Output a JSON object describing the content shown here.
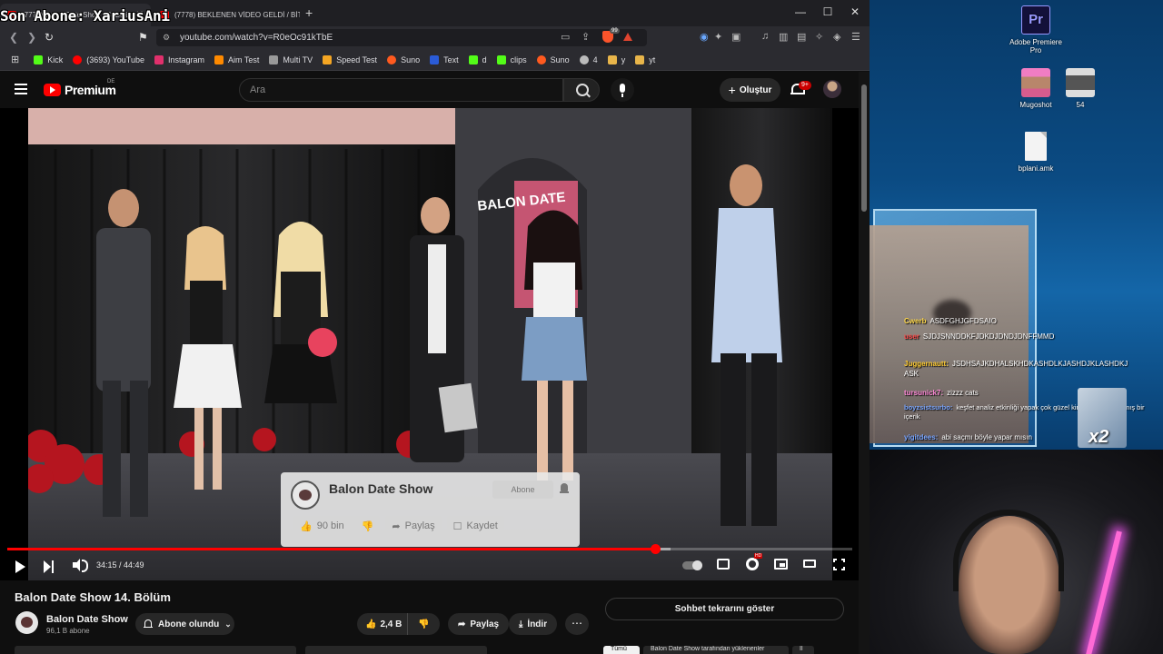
{
  "overlay": {
    "last_sub": "Son Abone: XariusAni"
  },
  "browser": {
    "tabs": [
      {
        "title": "(7777) Balon Date Show 14. Bölü"
      },
      {
        "title": "(7778) BEKLENEN VİDEO GELDİ / BİT"
      }
    ],
    "url": "youtube.com/watch?v=R0eOc91kTbE",
    "brave_badge": "99",
    "bookmarks": [
      {
        "label": "Kick",
        "color": "#53fc18"
      },
      {
        "label": "(3693) YouTube",
        "color": "#ff0000"
      },
      {
        "label": "Instagram",
        "color": "#e1306c"
      },
      {
        "label": "Aim Test",
        "color": "#ff8a00"
      },
      {
        "label": "Multi TV",
        "color": "#999999"
      },
      {
        "label": "Speed Test",
        "color": "#f5a623"
      },
      {
        "label": "Suno",
        "color": "#ff5a1f"
      },
      {
        "label": "Text",
        "color": "#2a5bd7"
      },
      {
        "label": "d",
        "color": "#53fc18"
      },
      {
        "label": "clips",
        "color": "#53fc18"
      },
      {
        "label": "Suno",
        "color": "#ff5a1f"
      },
      {
        "label": "4",
        "color": "#bbbbbb"
      },
      {
        "label": "y",
        "color": "#e8b54a"
      },
      {
        "label": "yt",
        "color": "#e8b54a"
      }
    ]
  },
  "youtube": {
    "logo_text": "Premium",
    "region": "DE",
    "search_placeholder": "Ara",
    "create_label": "Oluştur",
    "notification_count": "9+",
    "player": {
      "time": "34:15 / 44:49",
      "progress": 0.767,
      "buffered": 0.785,
      "card": {
        "channel": "Balon Date Show",
        "subscribe": "Abone",
        "likes": "90 bin",
        "share": "Paylaş",
        "save": "Kaydet"
      }
    },
    "video": {
      "title": "Balon Date Show 14. Bölüm",
      "channel": "Balon Date Show",
      "subscribers": "96,1 B abone",
      "subscribed_label": "Abone olundu",
      "likes": "2,4 B",
      "share": "Paylaş",
      "download": "İndir",
      "chat_replay": "Sohbet tekrarını göster",
      "chips": [
        "Tümü",
        "Balon Date Show tarafından yüklenenler",
        "İl"
      ]
    }
  },
  "desktop": {
    "icons": [
      {
        "label": "Adobe Premiere Pro",
        "glyph": "Pr"
      },
      {
        "label": "Mugoshot"
      },
      {
        "label": "54"
      },
      {
        "label": "bplani.amk"
      }
    ],
    "chat": [
      {
        "user": "Cwerb",
        "text": "ASDFGHJGFDSAIO",
        "color": "#ffd84a"
      },
      {
        "user": "user",
        "text": "SJDJSNNDDKFJDKDJDNDJDNFFMMD",
        "color": "#ff4a4a"
      },
      {
        "user": "Juggernautt:",
        "text": "JSDHSAJKDHALSKHDKASHDLKJASHDJKLASHDKJ",
        "color": "#ffcc33"
      },
      {
        "user": "",
        "text": "ASK",
        "color": "#ffffff"
      },
      {
        "user": "tursunick7:",
        "text": "zizzz cats",
        "color": "#ff8ad8"
      },
      {
        "user": "boyzsistsurbo:",
        "text": "keşfet analiz etkinliği yapak çok güzel kimsenin yapılmamış bir içerik",
        "color": "#7aa6ff"
      },
      {
        "user": "yigitdees:",
        "text": "abi saçmı böyle yapar mısın",
        "color": "#7aa6ff"
      }
    ],
    "multiplier": "x2"
  }
}
